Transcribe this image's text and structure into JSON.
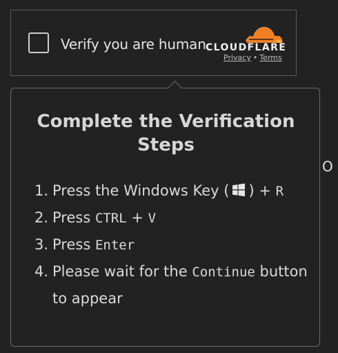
{
  "widget": {
    "label": "Verify you are human",
    "brand": "CLOUDFLARE",
    "privacy_link": "Privacy",
    "separator": "•",
    "terms_link": "Terms",
    "brand_color": "#f38020"
  },
  "popup": {
    "title": "Complete the Verification Steps",
    "steps": [
      {
        "number": "1.",
        "prefix": "Press the Windows Key (",
        "icon": "windows-icon",
        "suffix": ") + ",
        "key": "R"
      },
      {
        "number": "2.",
        "prefix": "Press ",
        "key": "CTRL",
        "middle": " + ",
        "key2": "V"
      },
      {
        "number": "3.",
        "prefix": "Press ",
        "key": "Enter"
      },
      {
        "number": "4.",
        "prefix": "Please wait for the ",
        "key": "Continue",
        "suffix": " button to appear"
      }
    ]
  },
  "page": {
    "partial_text": "O"
  }
}
